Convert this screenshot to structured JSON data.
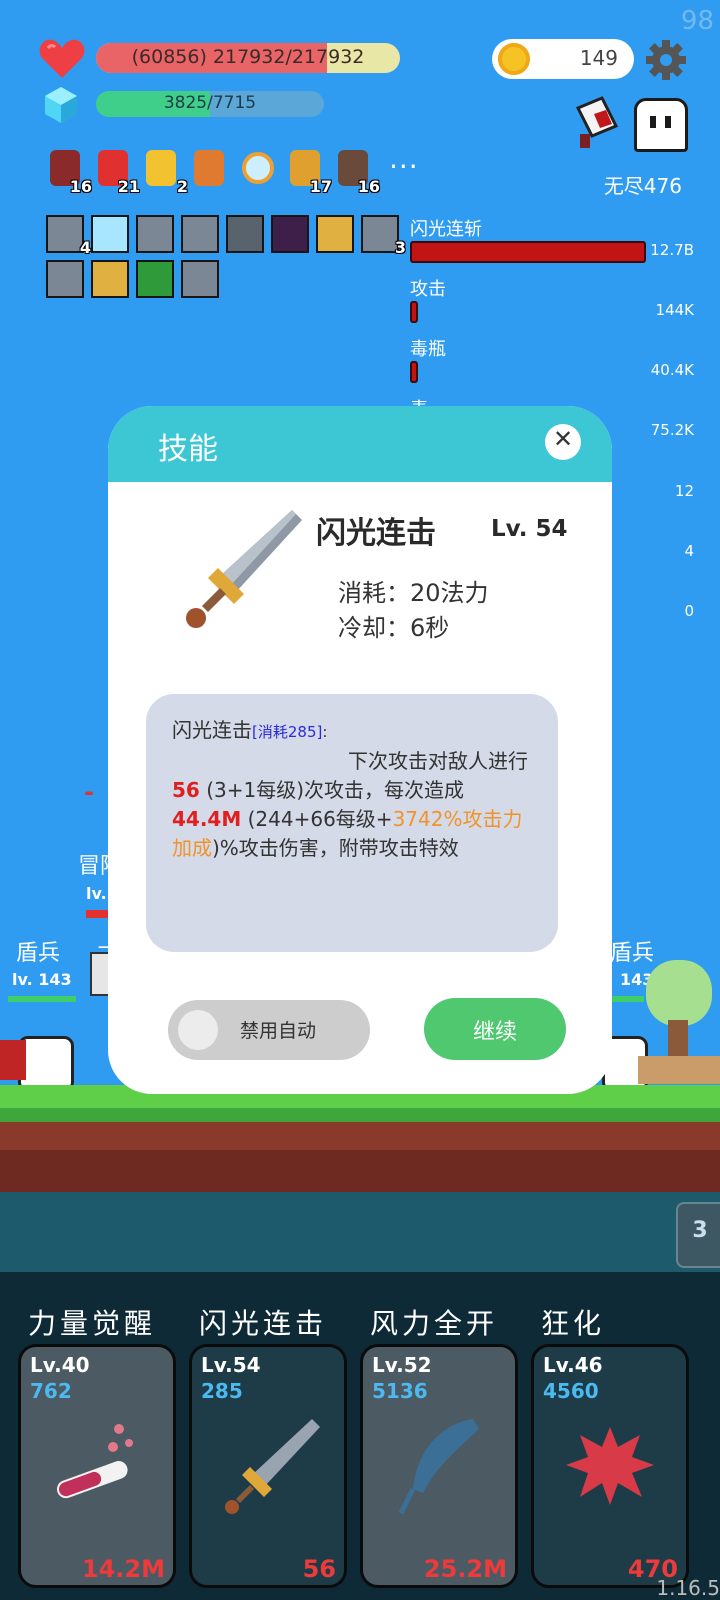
{
  "fps": "98",
  "hp": {
    "current_text": "(60856) 217932/217932",
    "fill": 0.76
  },
  "mp": {
    "text": "3825/7715",
    "fill": 0.5
  },
  "coins": "149",
  "endless": "无尽476",
  "items": [
    {
      "icon": "jar-icon",
      "count": "16"
    },
    {
      "icon": "sock-icon",
      "count": "21"
    },
    {
      "icon": "crown-icon",
      "count": "2"
    },
    {
      "icon": "torch-icon",
      "count": ""
    },
    {
      "icon": "magnifier-icon",
      "count": ""
    },
    {
      "icon": "book-icon",
      "count": "17"
    },
    {
      "icon": "door-icon",
      "count": "16"
    }
  ],
  "more_label": "···",
  "skill_badges_row1_last_count": "3",
  "skill_badges_row1_first_count": "4",
  "damage_stats": [
    {
      "name": "闪光连斩",
      "value": "12.7B",
      "fraction": 1.0
    },
    {
      "name": "攻击",
      "value": "144K",
      "fraction": 0.01
    },
    {
      "name": "毒瓶",
      "value": "40.4K",
      "fraction": 0.01
    },
    {
      "name": "毒",
      "value": "75.2K",
      "fraction": 0
    }
  ],
  "stat_extra_values": [
    "12",
    "4",
    "0"
  ],
  "modal": {
    "title": "技能",
    "close": "✕",
    "skill_name": "闪光连击",
    "level": "Lv. 54",
    "cost": "消耗：20法力",
    "cooldown": "冷却：6秒",
    "desc_name": "闪光连击",
    "desc_cost_tag": "[消耗285]",
    "desc_colon": ":",
    "desc_line1": "下次攻击对敌人进行",
    "desc_hits": "56",
    "desc_hits_rest": " (3+1每级)次攻击，每次造成",
    "desc_dmg": "44.4M",
    "desc_dmg_rest": " (244+66每级+",
    "desc_bonus": "3742%攻击力加成",
    "desc_tail": ")%攻击伤害，附带攻击特效",
    "toggle_label": "禁用自动",
    "continue_label": "继续"
  },
  "battle": {
    "left_name": "盾兵",
    "left_lv": "lv. 143",
    "right_name": "盾兵",
    "right_lv": "143",
    "adventurer": "冒险",
    "adv_lv": "lv.",
    "damage_text": "-",
    "partial_text": "三"
  },
  "side_button": "3",
  "skills": [
    {
      "name": "力量觉醒",
      "lv": "Lv.40",
      "cost": "762",
      "value": "14.2M",
      "icon": "potion-icon",
      "bg": "#4c5a63"
    },
    {
      "name": "闪光连击",
      "lv": "Lv.54",
      "cost": "285",
      "value": "56",
      "icon": "sword-icon",
      "bg": "#1e3c48"
    },
    {
      "name": "风力全开",
      "lv": "Lv.52",
      "cost": "5136",
      "value": "25.2M",
      "icon": "feather-icon",
      "bg": "#4c5a63"
    },
    {
      "name": "狂化",
      "lv": "Lv.46",
      "cost": "4560",
      "value": "470",
      "icon": "splat-icon",
      "bg": "#1e3c48"
    }
  ],
  "version": "1.16.5",
  "colors": {
    "sky": "#2f9cf2",
    "modal_header": "#3dc6d4",
    "continue": "#4fc870",
    "damage_red": "#e02020",
    "bonus_orange": "#f0932b",
    "cost_blue": "#2a2ad8"
  }
}
